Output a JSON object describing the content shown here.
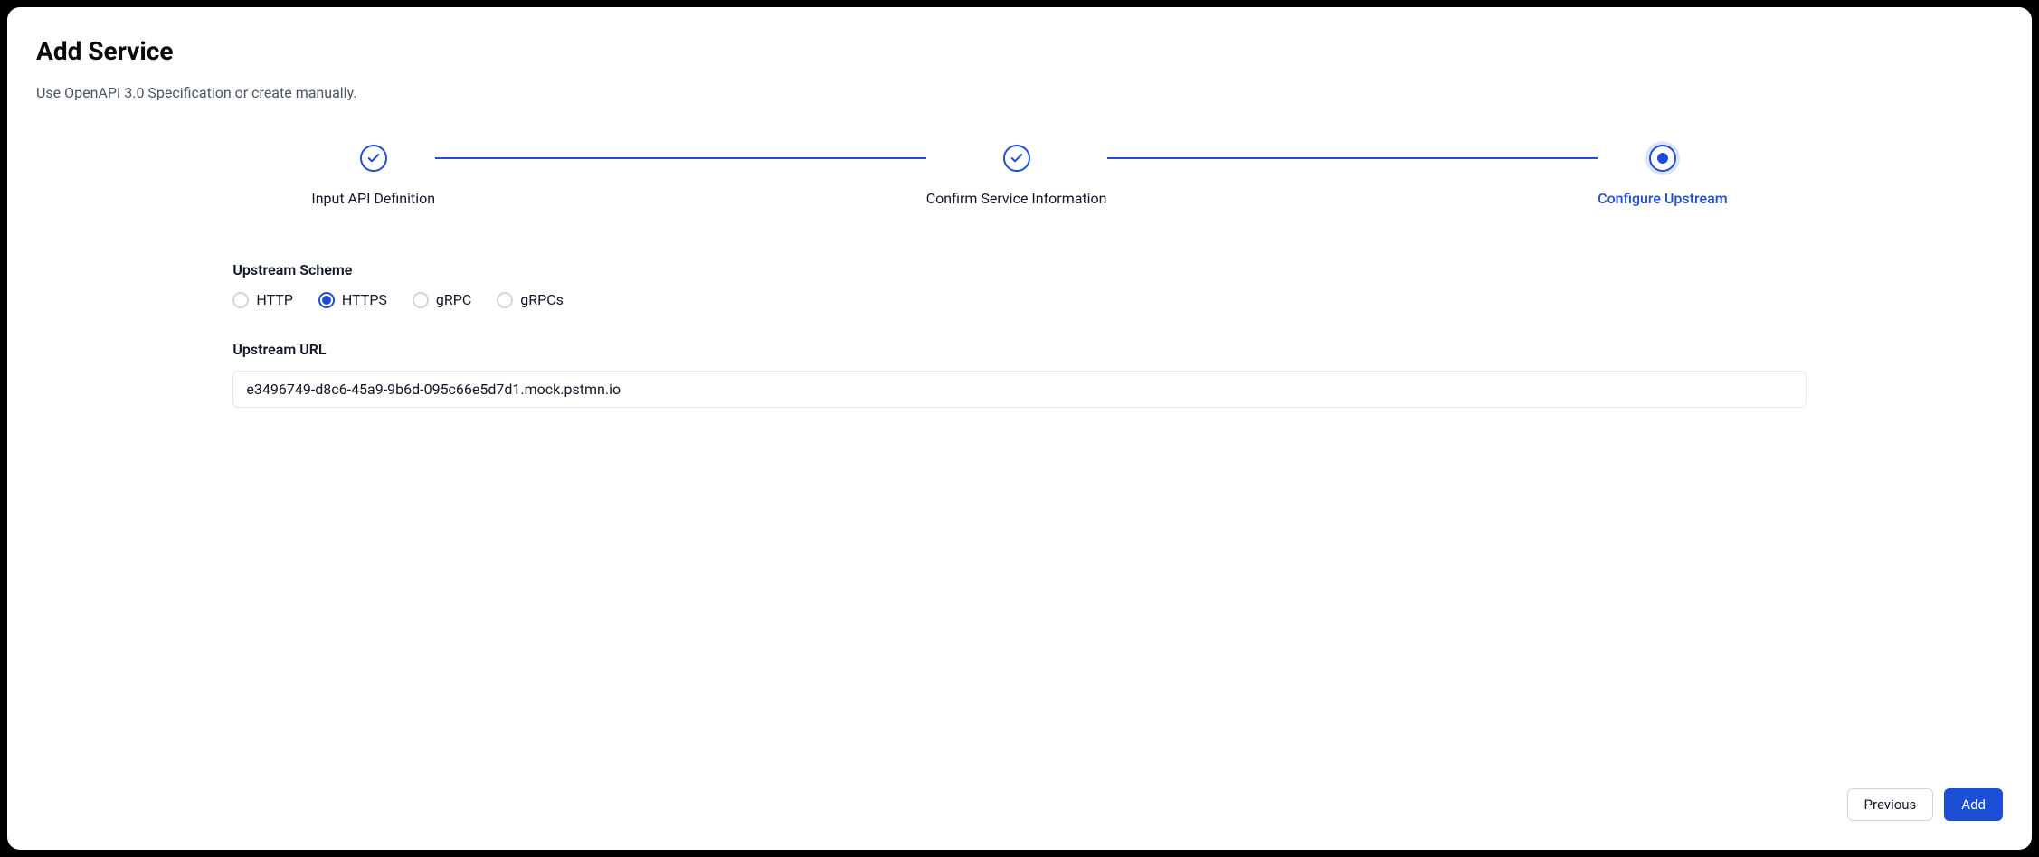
{
  "header": {
    "title": "Add Service",
    "subtitle": "Use OpenAPI 3.0 Specification or create manually."
  },
  "stepper": {
    "steps": [
      {
        "label": "Input API Definition",
        "state": "done"
      },
      {
        "label": "Confirm Service Information",
        "state": "done"
      },
      {
        "label": "Configure Upstream",
        "state": "current"
      }
    ]
  },
  "form": {
    "scheme": {
      "label": "Upstream Scheme",
      "options": [
        {
          "label": "HTTP",
          "selected": false
        },
        {
          "label": "HTTPS",
          "selected": true
        },
        {
          "label": "gRPC",
          "selected": false
        },
        {
          "label": "gRPCs",
          "selected": false
        }
      ]
    },
    "url": {
      "label": "Upstream URL",
      "value": "e3496749-d8c6-45a9-9b6d-095c66e5d7d1.mock.pstmn.io"
    }
  },
  "footer": {
    "previous": "Previous",
    "add": "Add"
  }
}
